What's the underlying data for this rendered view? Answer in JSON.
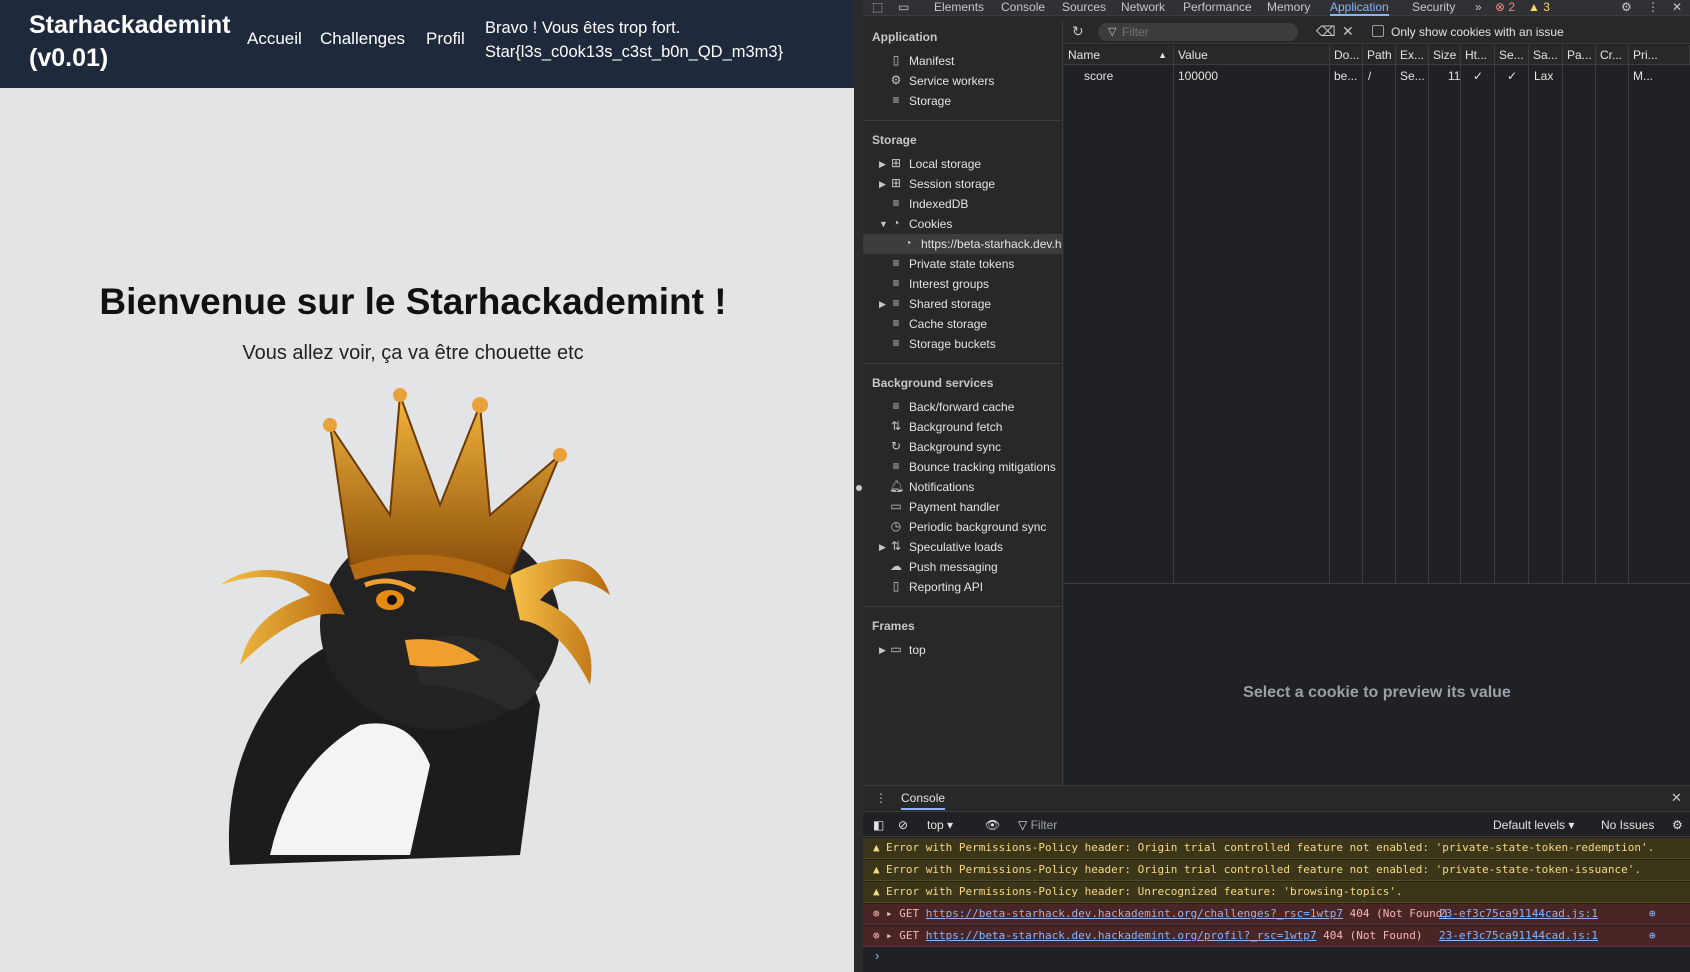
{
  "site": {
    "brand_line1": "Starhackademint",
    "brand_line2": "(v0.01)",
    "nav": [
      "Accueil",
      "Challenges",
      "Profil"
    ],
    "flag_line1": "Bravo ! Vous êtes trop fort.",
    "flag_line2": "Star{l3s_c0ok13s_c3st_b0n_QD_m3m3}",
    "hero_title": "Bienvenue sur le Starhackademint !",
    "hero_subtitle": "Vous allez voir, ça va être chouette etc",
    "colors": {
      "navbar": "#1e2a3b",
      "page_bg": "#e2e4e6"
    }
  },
  "devtools": {
    "tabs": [
      "Elements",
      "Console",
      "Sources",
      "Network",
      "Performance",
      "Memory",
      "Application",
      "Security"
    ],
    "active_tab": "Application",
    "more_tabs": "»",
    "error_count": "2",
    "warning_count": "3",
    "sidebar": {
      "application_title": "Application",
      "application_items": [
        "Manifest",
        "Service workers",
        "Storage"
      ],
      "storage_title": "Storage",
      "storage_items": [
        "Local storage",
        "Session storage",
        "IndexedDB",
        "Cookies",
        "https://beta-starhack.dev.h",
        "Private state tokens",
        "Interest groups",
        "Shared storage",
        "Cache storage",
        "Storage buckets"
      ],
      "bg_title": "Background services",
      "bg_items": [
        "Back/forward cache",
        "Background fetch",
        "Background sync",
        "Bounce tracking mitigations",
        "Notifications",
        "Payment handler",
        "Periodic background sync",
        "Speculative loads",
        "Push messaging",
        "Reporting API"
      ],
      "frames_title": "Frames",
      "frames_items": [
        "top"
      ]
    },
    "cookies": {
      "filter_placeholder": "Filter",
      "only_issue_label": "Only show cookies with an issue",
      "columns": [
        "Name",
        "Value",
        "Do...",
        "Path",
        "Ex...",
        "Size",
        "Ht...",
        "Se...",
        "Sa...",
        "Pa...",
        "Cr...",
        "Pri..."
      ],
      "rows": [
        [
          "score",
          "100000",
          "be...",
          "/",
          "Se...",
          "11",
          "✓",
          "✓",
          "Lax",
          "",
          "",
          "M..."
        ]
      ],
      "preview_message": "Select a cookie to preview its value"
    },
    "console": {
      "tab": "Console",
      "context": "top",
      "filter_placeholder": "Filter",
      "levels": "Default levels",
      "issues": "No Issues",
      "messages": [
        {
          "level": "warning",
          "text": "Error with Permissions-Policy header: Origin trial controlled feature not enabled: 'private-state-token-redemption'."
        },
        {
          "level": "warning",
          "text": "Error with Permissions-Policy header: Origin trial controlled feature not enabled: 'private-state-token-issuance'."
        },
        {
          "level": "warning",
          "text": "Error with Permissions-Policy header: Unrecognized feature: 'browsing-topics'."
        },
        {
          "level": "error",
          "method": "GET",
          "url": "https://beta-starhack.dev.hackademint.org/challenges?_rsc=1wtp7",
          "status": "404 (Not Found)",
          "source": "23-ef3c75ca91144cad.js:1"
        },
        {
          "level": "error",
          "method": "GET",
          "url": "https://beta-starhack.dev.hackademint.org/profil?_rsc=1wtp7",
          "status": "404 (Not Found)",
          "source": "23-ef3c75ca91144cad.js:1"
        }
      ]
    }
  }
}
